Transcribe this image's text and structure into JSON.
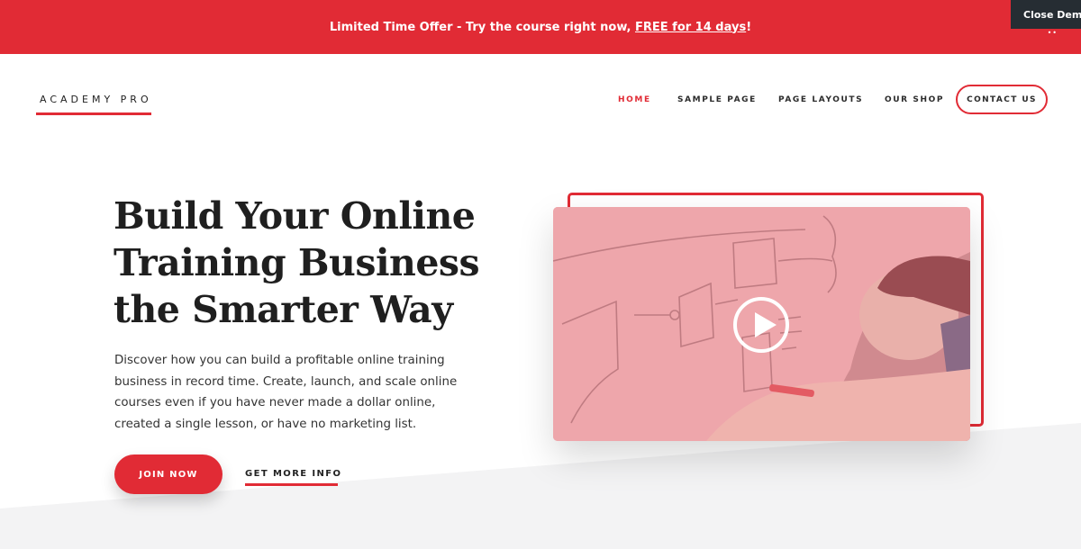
{
  "promo": {
    "text": "Limited Time Offer - Try the course right now, ",
    "link": "FREE for 14 days",
    "suffix": "!"
  },
  "close_demo": {
    "label": "Close Demo"
  },
  "header": {
    "logo": "ACADEMY PRO",
    "nav": [
      {
        "label": "HOME",
        "active": true
      },
      {
        "label": "SAMPLE PAGE"
      },
      {
        "label": "PAGE LAYOUTS"
      },
      {
        "label": "OUR SHOP"
      }
    ],
    "contact": "CONTACT US"
  },
  "hero": {
    "title_lines": [
      "Build Your Online",
      "Training Business",
      "the Smarter Way"
    ],
    "description_lines": [
      "Discover how you can build a profitable online training",
      "business in record time. Create, launch, and scale online",
      "courses even if you have never made a dollar online,",
      "created a single lesson, or have no marketing list."
    ],
    "primary_button": "JOIN NOW",
    "secondary_link": "GET MORE INFO"
  },
  "video": {
    "play_icon": "play-icon"
  },
  "colors": {
    "accent": "#e12b35",
    "dark": "#262d33",
    "bg_grey": "#f3f3f4"
  }
}
